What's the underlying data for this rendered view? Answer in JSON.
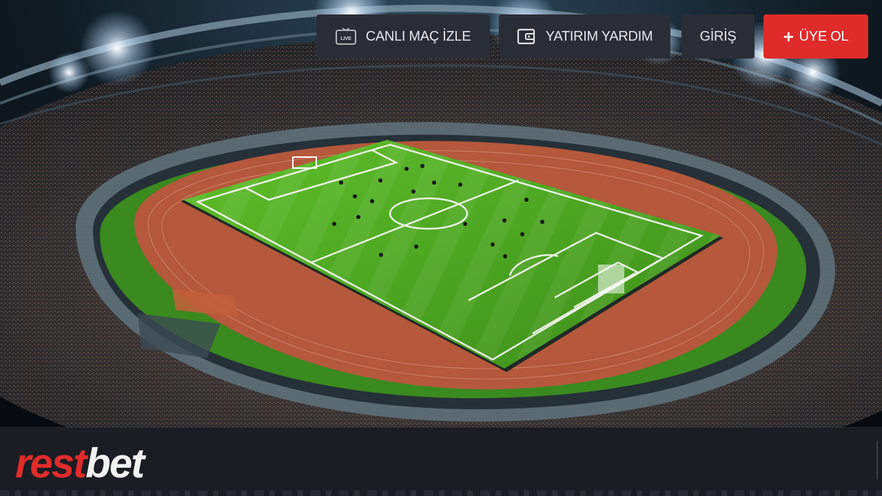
{
  "brand": {
    "logo_part1": "rest",
    "logo_part2": "bet",
    "primary_color": "#e02b2b",
    "bar_color": "#1b1d23",
    "button_color": "#2a2d36"
  },
  "hero": {
    "image_description": "night-stadium-hero",
    "field_color": "#3f8f1f",
    "track_color": "#b5583c"
  },
  "nav": {
    "live": {
      "label": "CANLI MAÇ İZLE",
      "icon": "live-tv-icon",
      "icon_text": "LIVE"
    },
    "deposit": {
      "label": "YATIRIM YARDIM",
      "icon": "wallet-icon"
    },
    "login": {
      "label": "GİRİŞ"
    },
    "register": {
      "label": "ÜYE OL",
      "icon": "plus-icon",
      "icon_text": "+"
    }
  }
}
